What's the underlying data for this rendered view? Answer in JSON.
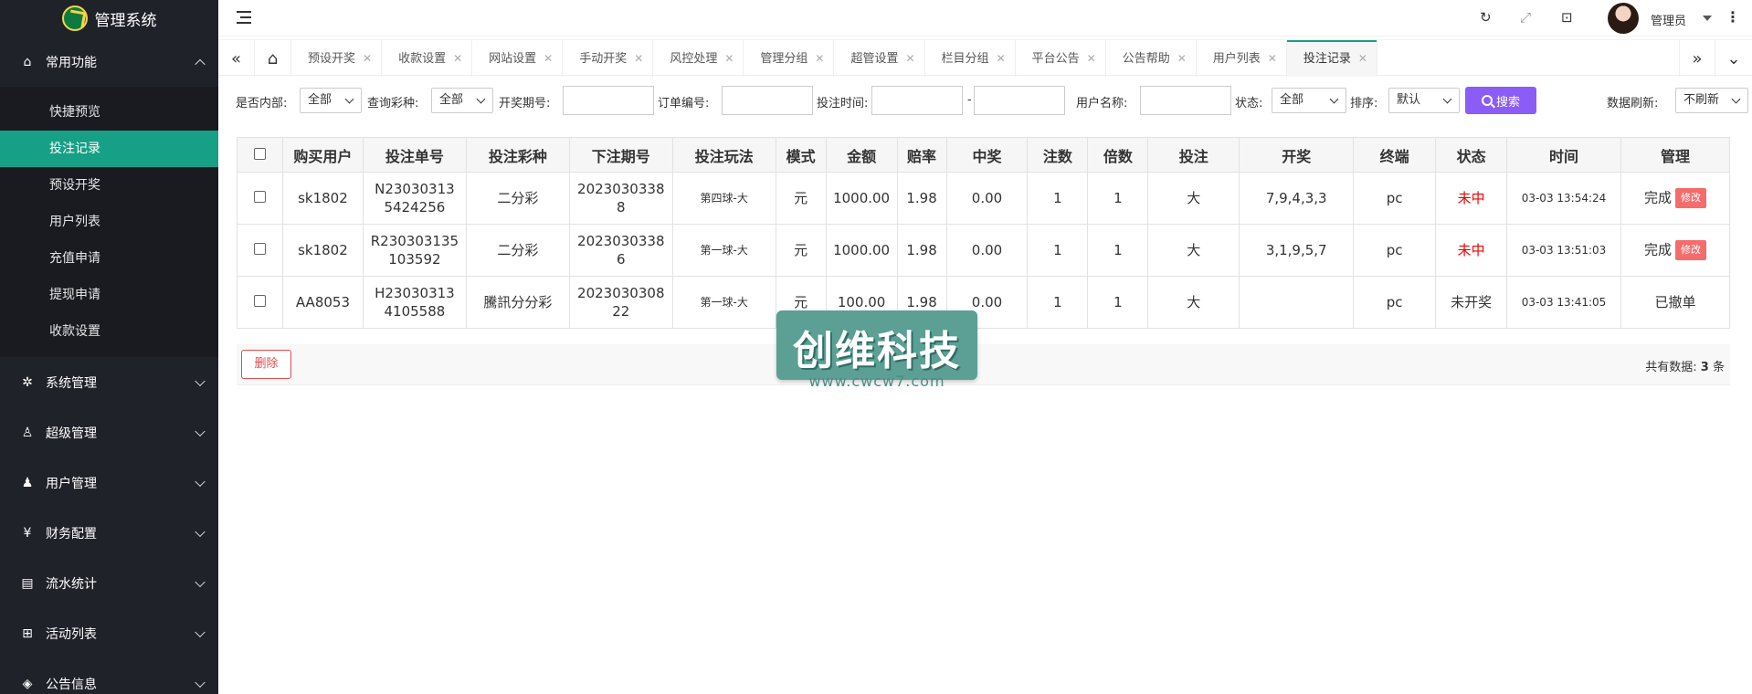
{
  "app": {
    "title": "管理系统"
  },
  "sidebar": {
    "groups": [
      {
        "label": "常用功能",
        "icon": "home-icon",
        "expanded": true,
        "items": [
          "快捷预览",
          "投注记录",
          "预设开奖",
          "用户列表",
          "充值申请",
          "提现申请",
          "收款设置"
        ],
        "active_index": 1
      },
      {
        "label": "系统管理",
        "icon": "gear-icon"
      },
      {
        "label": "超级管理",
        "icon": "user-icon"
      },
      {
        "label": "用户管理",
        "icon": "users-icon"
      },
      {
        "label": "财务配置",
        "icon": "money-icon"
      },
      {
        "label": "流水统计",
        "icon": "report-icon"
      },
      {
        "label": "活动列表",
        "icon": "gift-icon"
      },
      {
        "label": "公告信息",
        "icon": "announce-icon"
      }
    ]
  },
  "header": {
    "admin_name": "管理员"
  },
  "tabs": {
    "items": [
      "预设开奖",
      "收款设置",
      "网站设置",
      "手动开奖",
      "风控处理",
      "管理分组",
      "超管设置",
      "栏目分组",
      "平台公告",
      "公告帮助",
      "用户列表",
      "投注记录"
    ],
    "active_index": 11
  },
  "filter": {
    "internal_label": "是否内部:",
    "internal_value": "全部",
    "lottery_label": "查询彩种:",
    "lottery_value": "全部",
    "period_label": "开奖期号:",
    "order_label": "订单编号:",
    "time_label": "投注时间:",
    "time_sep": "-",
    "username_label": "用户名称:",
    "status_label": "状态:",
    "status_value": "全部",
    "sort_label": "排序:",
    "sort_value": "默认",
    "search_label": "搜索",
    "refresh_label": "数据刷新:",
    "refresh_value": "不刷新"
  },
  "table": {
    "headers": [
      "购买用户",
      "投注单号",
      "投注彩种",
      "下注期号",
      "投注玩法",
      "模式",
      "金额",
      "赔率",
      "中奖",
      "注数",
      "倍数",
      "投注",
      "开奖",
      "终端",
      "状态",
      "时间",
      "管理"
    ],
    "rows": [
      {
        "user": "sk1802",
        "order_a": "N23030313",
        "order_b": "5424256",
        "lottery": "二分彩",
        "period_a": "2023030338",
        "period_b": "8",
        "play": "第四球-大",
        "mode": "元",
        "amount": "1000.00",
        "odds": "1.98",
        "win": "0.00",
        "count": "1",
        "multiple": "1",
        "bet": "大",
        "draw": "7,9,4,3,3",
        "terminal": "pc",
        "status": "未中",
        "time": "03-03 13:54:24",
        "manage": "完成",
        "edit": "修改"
      },
      {
        "user": "sk1802",
        "order_a": "R230303135",
        "order_b": "103592",
        "lottery": "二分彩",
        "period_a": "2023030338",
        "period_b": "6",
        "play": "第一球-大",
        "mode": "元",
        "amount": "1000.00",
        "odds": "1.98",
        "win": "0.00",
        "count": "1",
        "multiple": "1",
        "bet": "大",
        "draw": "3,1,9,5,7",
        "terminal": "pc",
        "status": "未中",
        "time": "03-03 13:51:03",
        "manage": "完成",
        "edit": "修改"
      },
      {
        "user": "AA8053",
        "order_a": "H23030313",
        "order_b": "4105588",
        "lottery": "騰訊分分彩",
        "period_a": "2023030308",
        "period_b": "22",
        "play": "第一球-大",
        "mode": "元",
        "amount": "100.00",
        "odds": "1.98",
        "win": "0.00",
        "count": "1",
        "multiple": "1",
        "bet": "大",
        "draw": "",
        "terminal": "pc",
        "status": "未开奖",
        "time": "03-03 13:41:05",
        "manage": "已撤单",
        "edit": ""
      }
    ]
  },
  "footer": {
    "delete_label": "删除",
    "total_prefix": "共有数据:",
    "total_count": "3",
    "total_suffix": "条"
  },
  "watermark": {
    "text": "创维科技",
    "url": "www.cwcw7.com"
  },
  "colors": {
    "accent": "#16a085",
    "sidebar_bg": "#20222a",
    "search_btn": "#8b5cf6",
    "lose": "#ee0000",
    "edit": "#f56c6c"
  }
}
